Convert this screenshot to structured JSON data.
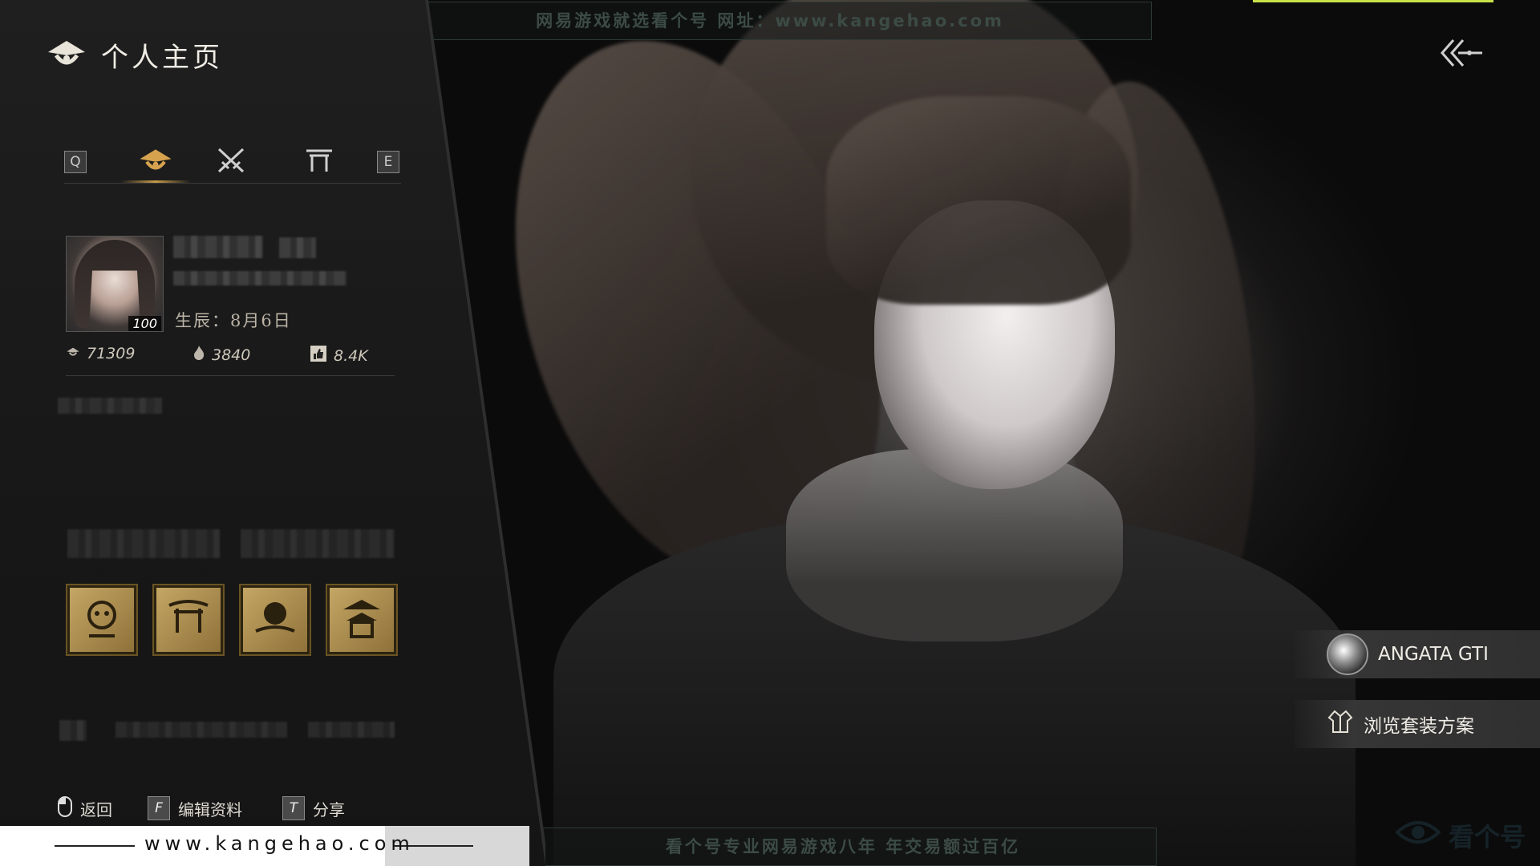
{
  "header": {
    "title": "个人主页"
  },
  "tabs": {
    "left_key": "Q",
    "right_key": "E",
    "items": [
      {
        "icon": "emblem-icon",
        "active": true
      },
      {
        "icon": "crossed-swords-icon",
        "active": false
      },
      {
        "icon": "gate-icon",
        "active": false
      }
    ]
  },
  "profile": {
    "level": "100",
    "birthday": "生辰：8月6日"
  },
  "stats": [
    {
      "icon": "emblem-small-icon",
      "value": "71309"
    },
    {
      "icon": "flame-icon",
      "value": "3840"
    },
    {
      "icon": "thumbs-up-icon",
      "value": "8.4K"
    }
  ],
  "badges": [
    "lion-badge-icon",
    "gate-badge-icon",
    "moon-badge-icon",
    "pagoda-badge-icon"
  ],
  "hints": [
    {
      "key_icon": "mouse-icon",
      "label": "返回"
    },
    {
      "key": "F",
      "label": "编辑资料"
    },
    {
      "key": "T",
      "label": "分享"
    }
  ],
  "watermark": {
    "bottom_text": "www.kangehao.com",
    "top_banner": "网易游戏就选看个号 网址：www.kangehao.com",
    "bottom_banner": "看个号专业网易游戏八年 年交易额过百亿",
    "corner_logo": "看个号"
  },
  "side_buttons": [
    {
      "label": "ANGATA GTI",
      "icon": "outfit-avatar"
    },
    {
      "label": "浏览套装方案",
      "icon": "outfit-icon"
    }
  ],
  "colors": {
    "accent_gold": "#c49a4a",
    "top_accent": "#c8e34a"
  }
}
